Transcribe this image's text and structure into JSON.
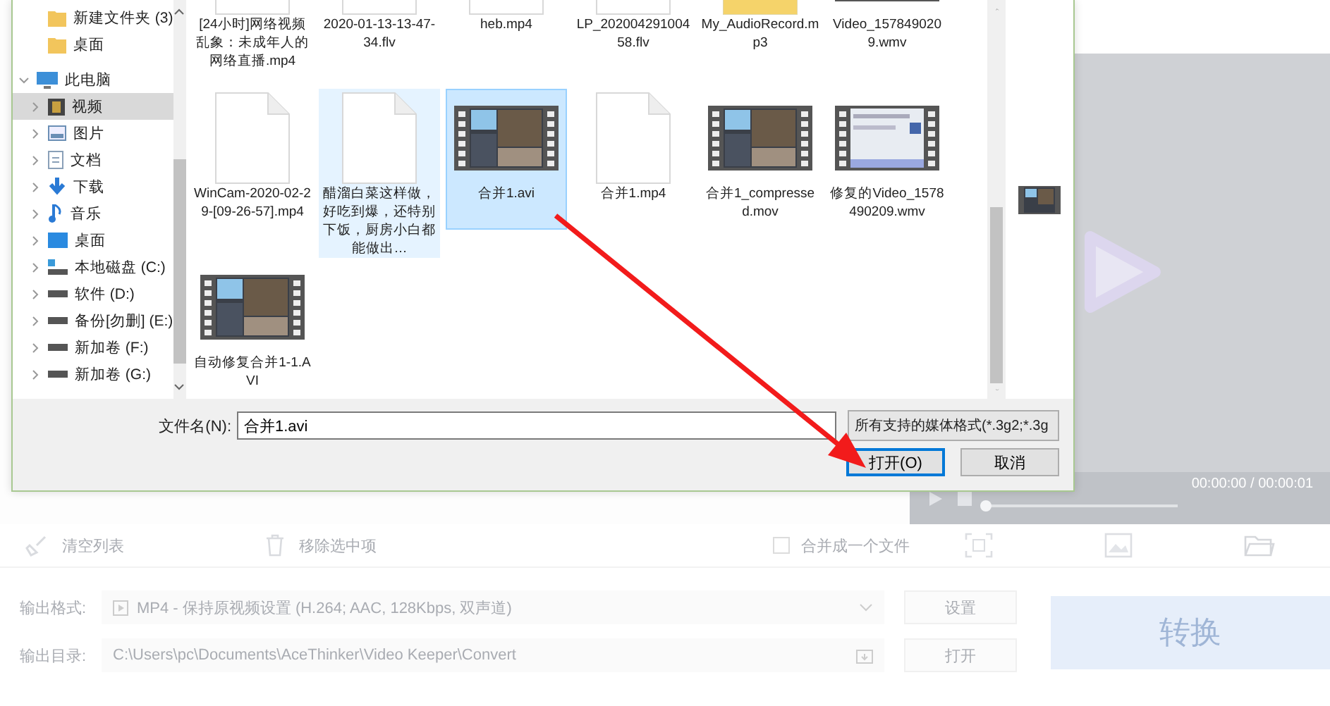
{
  "dialog": {
    "nav": [
      {
        "label": "新建文件夹 (3)",
        "kind": "folder",
        "selected": false
      },
      {
        "label": "桌面",
        "kind": "folder",
        "selected": false
      },
      {
        "label": "此电脑",
        "kind": "computer",
        "selected": false,
        "expanded": true,
        "children": [
          {
            "label": "视频",
            "kind": "video",
            "selected": true,
            "expanded": false
          },
          {
            "label": "图片",
            "kind": "picture",
            "selected": false,
            "expanded": false
          },
          {
            "label": "文档",
            "kind": "document",
            "selected": false,
            "expanded": false
          },
          {
            "label": "下载",
            "kind": "download",
            "selected": false,
            "expanded": false
          },
          {
            "label": "音乐",
            "kind": "music",
            "selected": false,
            "expanded": false
          },
          {
            "label": "桌面",
            "kind": "desktop",
            "selected": false,
            "expanded": false
          },
          {
            "label": "本地磁盘 (C:)",
            "kind": "system-drive",
            "selected": false,
            "expanded": false
          },
          {
            "label": "软件 (D:)",
            "kind": "drive",
            "selected": false,
            "expanded": false
          },
          {
            "label": "备份[勿删] (E:)",
            "kind": "drive",
            "selected": false,
            "expanded": false
          },
          {
            "label": "新加卷 (F:)",
            "kind": "drive",
            "selected": false,
            "expanded": false
          },
          {
            "label": "新加卷 (G:)",
            "kind": "drive",
            "selected": false,
            "expanded": false
          }
        ]
      }
    ],
    "files": [
      {
        "name": "[24小时]网络视频乱象：未成年人的网络直播.mp4",
        "kind": "doc",
        "selected": false,
        "hovered": false
      },
      {
        "name": "2020-01-13-13-47-34.flv",
        "kind": "doc",
        "selected": false,
        "hovered": false
      },
      {
        "name": "heb.mp4",
        "kind": "doc",
        "selected": false,
        "hovered": false
      },
      {
        "name": "LP_20200429100458.flv",
        "kind": "doc",
        "selected": false,
        "hovered": false
      },
      {
        "name": "My_AudioRecord.mp3",
        "kind": "audio",
        "selected": false,
        "hovered": false
      },
      {
        "name": "Video_1578490209.wmv",
        "kind": "video",
        "selected": false,
        "hovered": false
      },
      {
        "name": "WinCam-2020-02-29-[09-26-57].mp4",
        "kind": "doc",
        "selected": false,
        "hovered": false
      },
      {
        "name": "醋溜白菜这样做，好吃到爆，还特别下饭，厨房小白都能做出…",
        "kind": "doc",
        "selected": false,
        "hovered": true
      },
      {
        "name": "合并1.avi",
        "kind": "video",
        "selected": true,
        "hovered": false
      },
      {
        "name": "合并1.mp4",
        "kind": "doc",
        "selected": false,
        "hovered": false
      },
      {
        "name": "合并1_compressed.mov",
        "kind": "video",
        "selected": false,
        "hovered": false
      },
      {
        "name": "修复的Video_1578490209.wmv",
        "kind": "screen-video",
        "selected": false,
        "hovered": false
      },
      {
        "name": "自动修复合并1-1.AVI",
        "kind": "video",
        "selected": false,
        "hovered": false
      }
    ],
    "filename_label": "文件名(N):",
    "filename_value": "合并1.avi",
    "filetype": "所有支持的媒体格式(*.3g2;*.3g",
    "buttons": [
      {
        "label": "打开(O)",
        "kind": "primary"
      },
      {
        "label": "取消",
        "kind": "normal"
      }
    ]
  },
  "app": {
    "player": {
      "level": 0,
      "time": "00:00:00 / 00:00:01"
    },
    "toolbar": [
      {
        "label": "清空列表",
        "kind": "broom"
      },
      {
        "label": "移除选中项",
        "kind": "trash"
      }
    ],
    "merge": {
      "label": "合并成一个文件",
      "checked": false
    },
    "output_format": {
      "label": "输出格式:",
      "value": "MP4 - 保持原视频设置 (H.264; AAC, 128Kbps, 双声道)",
      "button": "设置"
    },
    "output_dir": {
      "label": "输出目录:",
      "value": "C:\\Users\\pc\\Documents\\AceThinker\\Video Keeper\\Convert",
      "button": "打开"
    },
    "convert_button": "转换"
  }
}
